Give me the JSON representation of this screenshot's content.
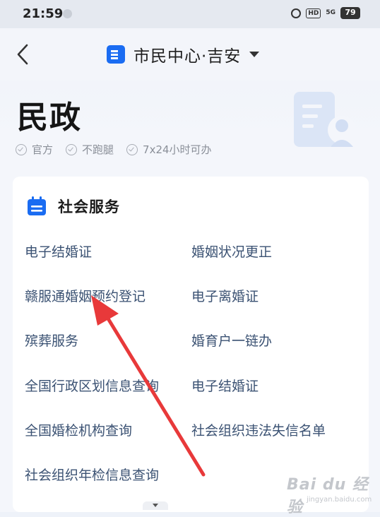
{
  "status_bar": {
    "time": "21:59",
    "hd_label": "HD",
    "network_label": "5G",
    "battery_level": "79"
  },
  "nav": {
    "title": "市民中心·吉安"
  },
  "header": {
    "title": "民政",
    "badges": [
      "官方",
      "不跑腿",
      "7x24小时可办"
    ]
  },
  "section": {
    "title": "社会服务",
    "items": [
      "电子结婚证",
      "婚姻状况更正",
      "赣服通婚姻预约登记",
      "电子离婚证",
      "殡葬服务",
      "婚育户一链办",
      "全国行政区划信息查询",
      "电子结婚证",
      "全国婚检机构查询",
      "社会组织违法失信名单",
      "社会组织年检信息查询"
    ]
  },
  "watermark": {
    "main": "Bai du 经验",
    "sub": "jingyan.baidu.com"
  },
  "colors": {
    "accent": "#1a6cf2",
    "item_text": "#3b5273",
    "annotation_arrow": "#e8393a"
  }
}
